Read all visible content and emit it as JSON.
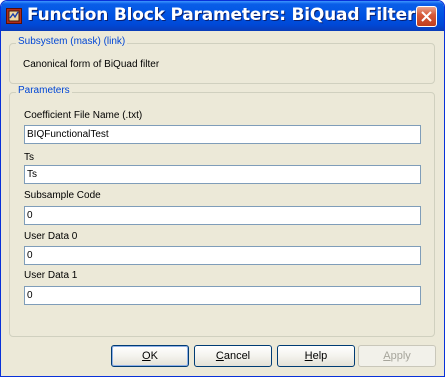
{
  "window": {
    "title": "Function Block Parameters: BiQuad Filter",
    "icon": "simulink-block-icon"
  },
  "subsystem": {
    "legend": "Subsystem (mask) (link)",
    "description": "Canonical form of BiQuad filter"
  },
  "parameters": {
    "legend": "Parameters",
    "fields": [
      {
        "label": "Coefficient File Name (.txt)",
        "value": "BIQFunctionalTest"
      },
      {
        "label": "Ts",
        "value": "Ts"
      },
      {
        "label": "Subsample Code",
        "value": "0"
      },
      {
        "label": "User Data 0",
        "value": "0"
      },
      {
        "label": "User Data 1",
        "value": "0"
      }
    ]
  },
  "buttons": {
    "ok": {
      "prefix": "",
      "mnemonic": "O",
      "rest": "K"
    },
    "cancel": {
      "prefix": "",
      "mnemonic": "C",
      "rest": "ancel"
    },
    "help": {
      "prefix": "",
      "mnemonic": "H",
      "rest": "elp"
    },
    "apply": {
      "prefix": "",
      "mnemonic": "A",
      "rest": "pply",
      "enabled": false
    }
  }
}
